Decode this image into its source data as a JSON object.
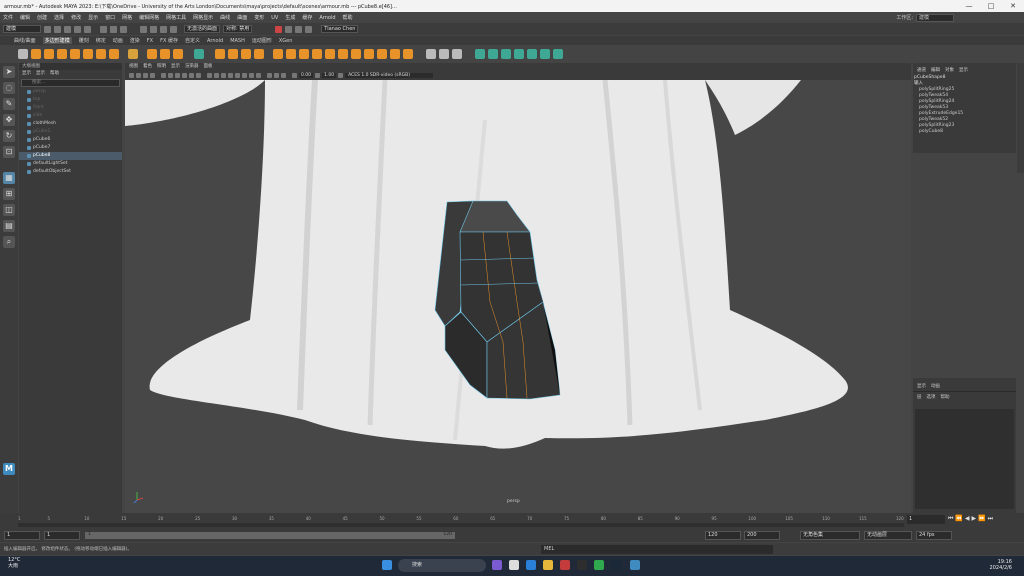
{
  "titlebar": {
    "title": "armour.mb* - Autodesk MAYA 2023: E:\\下载\\OneDrive - University of the Arts London\\Documents\\maya\\projects\\default\\scenes\\armour.mb --- pCube8.e[46]...",
    "minimize": "—",
    "maximize": "□",
    "close": "✕"
  },
  "menubar": [
    "文件",
    "编辑",
    "创建",
    "选择",
    "修改",
    "显示",
    "窗口",
    "网格",
    "编辑网格",
    "网格工具",
    "网格显示",
    "曲线",
    "曲面",
    "变形",
    "UV",
    "生成",
    "缓存",
    "Arnold",
    "帮助"
  ],
  "workspace": {
    "label": "工作区:",
    "value": "建模"
  },
  "statusline": {
    "mode": "建模",
    "no_live_surface": "无激活的曲面",
    "symmetry": "对称: 禁用",
    "user": "Tianao Chen"
  },
  "shelf_tabs": [
    "曲线/曲面",
    "多边形建模",
    "雕刻",
    "绑定",
    "动画",
    "渲染",
    "FX",
    "FX 缓存",
    "自定义",
    "Arnold",
    "MASH",
    "运动图形",
    "XGen"
  ],
  "shelf_active_tab": "多边形建模",
  "outliner": {
    "header": "大纲视图",
    "menu": [
      "显示",
      "显示",
      "帮助"
    ],
    "search_placeholder": "搜索...",
    "items": [
      {
        "name": "persp",
        "dim": true
      },
      {
        "name": "top",
        "dim": true
      },
      {
        "name": "front",
        "dim": true
      },
      {
        "name": "side",
        "dim": true
      },
      {
        "name": "clothMesh",
        "dim": false
      },
      {
        "name": "pCube1",
        "dim": true
      },
      {
        "name": "pCube6",
        "dim": false
      },
      {
        "name": "pCube7",
        "dim": false
      },
      {
        "name": "pCube8",
        "dim": false,
        "selected": true
      },
      {
        "name": "defaultLightSet",
        "dim": false
      },
      {
        "name": "defaultObjectSet",
        "dim": false
      }
    ]
  },
  "viewport": {
    "menu": [
      "视图",
      "着色",
      "照明",
      "显示",
      "渲染器",
      "面板"
    ],
    "value_a": "0.00",
    "value_b": "1.00",
    "colorspace": "ACES 1.0 SDR-video (sRGB)",
    "camera": "persp"
  },
  "attribute_panel": {
    "tabs": [
      "通道",
      "编辑",
      "对象",
      "显示"
    ],
    "node": "pCubeShape8",
    "inputs_label": "输入",
    "inputs": [
      "polySplitRing25",
      "polyTweak54",
      "polySplitRing24",
      "polyTweak53",
      "polyExtrudeEdge15",
      "polyTweak52",
      "polySplitRing23",
      "polyCube8"
    ]
  },
  "layer_panel": {
    "tabs": [
      "显示",
      "动画"
    ],
    "menu": [
      "层",
      "选项",
      "帮助"
    ]
  },
  "timeline": {
    "ticks": [
      1,
      5,
      10,
      15,
      20,
      25,
      30,
      35,
      40,
      45,
      50,
      55,
      60,
      65,
      70,
      75,
      80,
      85,
      90,
      95,
      100,
      105,
      110,
      115,
      120
    ],
    "current_frame": "1",
    "playback_icons": [
      "⏮",
      "⏪",
      "◀",
      "▶",
      "⏩",
      "⏭"
    ]
  },
  "range": {
    "start": "1",
    "start_inner": "1",
    "bar_start": "1",
    "bar_end": "120",
    "end_inner": "120",
    "end": "200",
    "char_set": "无角色集",
    "anim_layer": "无动画层",
    "fps": "24 fps"
  },
  "command_line": {
    "mode": "MEL",
    "help": "插入编辑器开启。 修改组件状态。 (拖动移动端已插入编辑器)。"
  },
  "taskbar": {
    "temp": "12°C",
    "weather": "大雨",
    "search": "搜索",
    "time": "19:16",
    "date": "2024/2/6"
  },
  "colors": {
    "accent": "#5285a6",
    "cloth": "#e6e6e6",
    "mesh": "#2b2b2b",
    "wire": "#6fc6e8",
    "edge_sel": "#e8922a"
  }
}
